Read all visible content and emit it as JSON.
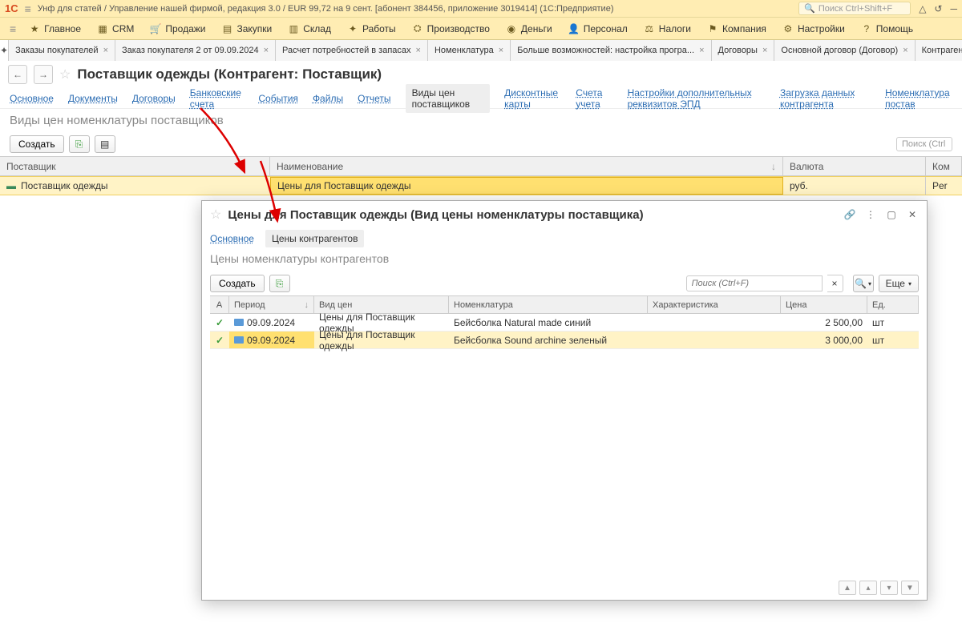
{
  "title_bar": {
    "logo": "1C",
    "title": "Унф для статей / Управление нашей фирмой, редакция 3.0 / EUR 99,72 на 9 сент. [абонент 384456, приложение 3019414]  (1С:Предприятие)",
    "search_placeholder": "Поиск Ctrl+Shift+F"
  },
  "menu": [
    {
      "label": "Главное"
    },
    {
      "label": "CRM"
    },
    {
      "label": "Продажи"
    },
    {
      "label": "Закупки"
    },
    {
      "label": "Склад"
    },
    {
      "label": "Работы"
    },
    {
      "label": "Производство"
    },
    {
      "label": "Деньги"
    },
    {
      "label": "Персонал"
    },
    {
      "label": "Налоги"
    },
    {
      "label": "Компания"
    },
    {
      "label": "Настройки"
    },
    {
      "label": "Помощь"
    }
  ],
  "tabs": [
    "Заказы покупателей",
    "Заказ покупателя 2 от 09.09.2024",
    "Расчет потребностей в запасах",
    "Номенклатура",
    "Больше возможностей: настройка програ...",
    "Договоры",
    "Основной договор (Договор)",
    "Контрагенты: Поставщики"
  ],
  "page": {
    "title": "Поставщик одежды (Контрагент: Поставщик)",
    "links": [
      "Основное",
      "Документы",
      "Договоры",
      "Банковские счета",
      "События",
      "Файлы",
      "Отчеты"
    ],
    "active_link": "Виды цен поставщиков",
    "links_after": [
      "Дисконтные карты",
      "Счета учета",
      "Настройки дополнительных реквизитов ЭПД",
      "Загрузка данных контрагента",
      "Номенклатура постав"
    ],
    "sub_title": "Виды цен номенклатуры поставщиков",
    "create": "Создать",
    "search_placeholder": "Поиск (Ctrl"
  },
  "main_table": {
    "headers": {
      "supplier": "Поставщик",
      "name": "Наименование",
      "currency": "Валюта",
      "com": "Ком"
    },
    "rows": [
      {
        "supplier": "Поставщик одежды",
        "name": "Цены для Поставщик одежды",
        "currency": "руб.",
        "com": "Per"
      }
    ]
  },
  "popup": {
    "title": "Цены для Поставщик одежды (Вид цены номенклатуры поставщика)",
    "tabs": {
      "main": "Основное",
      "active": "Цены контрагентов"
    },
    "sub_title": "Цены номенклатуры контрагентов",
    "create": "Создать",
    "search_placeholder": "Поиск (Ctrl+F)",
    "more": "Еще",
    "headers": {
      "a": "А",
      "period": "Период",
      "type": "Вид цен",
      "nom": "Номенклатура",
      "char": "Характеристика",
      "price": "Цена",
      "unit": "Ед."
    },
    "rows": [
      {
        "period": "09.09.2024",
        "type": "Цены для Поставщик одежды",
        "nom": "Бейсболка Natural made синий",
        "char": "",
        "price": "2 500,00",
        "unit": "шт"
      },
      {
        "period": "09.09.2024",
        "type": "Цены для Поставщик одежды",
        "nom": "Бейсболка Sound archine зеленый",
        "char": "",
        "price": "3 000,00",
        "unit": "шт"
      }
    ]
  }
}
